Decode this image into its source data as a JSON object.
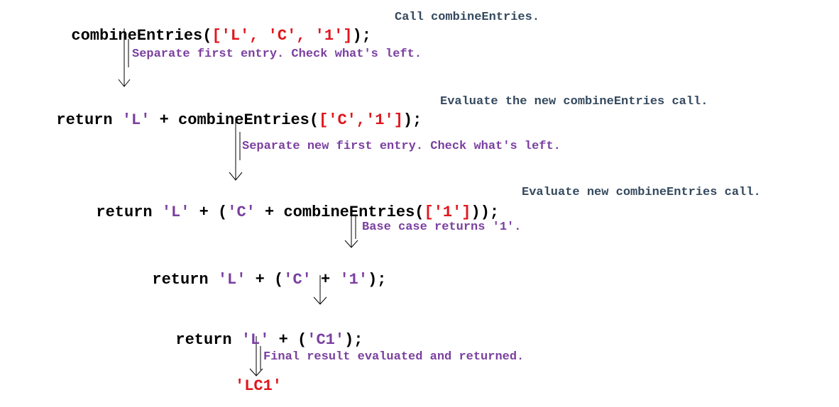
{
  "colors": {
    "keyword": "#000000",
    "bracket": "#e0161c",
    "string": "#7a3fa0",
    "note_slate": "#34495e",
    "note_purple": "#7a3fa0"
  },
  "steps": [
    {
      "segments": [
        {
          "t": "combineEntries(",
          "c": "k"
        },
        {
          "t": "['L', 'C', '1']",
          "c": "r"
        },
        {
          "t": ");",
          "c": "k"
        }
      ],
      "note": "Call combineEntries."
    },
    {
      "segments": [
        {
          "t": "return ",
          "c": "k"
        },
        {
          "t": "'L'",
          "c": "p"
        },
        {
          "t": " + combineEntries(",
          "c": "k"
        },
        {
          "t": "['C','1']",
          "c": "r"
        },
        {
          "t": ");",
          "c": "k"
        }
      ],
      "note": "Evaluate the new combineEntries call."
    },
    {
      "segments": [
        {
          "t": "return ",
          "c": "k"
        },
        {
          "t": "'L'",
          "c": "p"
        },
        {
          "t": " + (",
          "c": "k"
        },
        {
          "t": "'C'",
          "c": "p"
        },
        {
          "t": " + combineEntries(",
          "c": "k"
        },
        {
          "t": "['1']",
          "c": "r"
        },
        {
          "t": "));",
          "c": "k"
        }
      ],
      "note": "Evaluate new combineEntries call."
    },
    {
      "segments": [
        {
          "t": "return ",
          "c": "k"
        },
        {
          "t": "'L'",
          "c": "p"
        },
        {
          "t": " + (",
          "c": "k"
        },
        {
          "t": "'C'",
          "c": "p"
        },
        {
          "t": " + ",
          "c": "k"
        },
        {
          "t": "'1'",
          "c": "p"
        },
        {
          "t": ");",
          "c": "k"
        }
      ],
      "note": ""
    },
    {
      "segments": [
        {
          "t": "return ",
          "c": "k"
        },
        {
          "t": "'L'",
          "c": "p"
        },
        {
          "t": " + (",
          "c": "k"
        },
        {
          "t": "'C1'",
          "c": "p"
        },
        {
          "t": ");",
          "c": "k"
        }
      ],
      "note": ""
    }
  ],
  "transitions": [
    "Separate first entry. Check what's left.",
    "Separate new first entry. Check what's left.",
    "Base case returns '1'.",
    "",
    "Final result evaluated and returned."
  ],
  "result": "'LC1'"
}
